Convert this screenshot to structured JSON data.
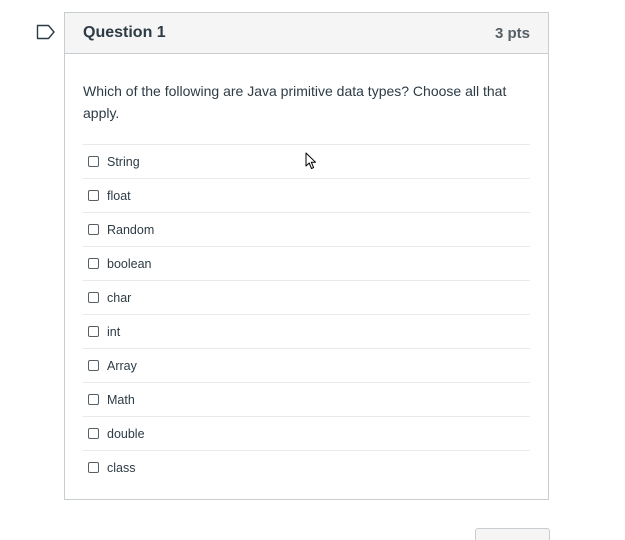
{
  "question": {
    "title": "Question 1",
    "points": "3 pts",
    "text": "Which of the following are Java primitive data types? Choose all that apply.",
    "answers": [
      {
        "label": "String"
      },
      {
        "label": "float"
      },
      {
        "label": "Random"
      },
      {
        "label": "boolean"
      },
      {
        "label": "char"
      },
      {
        "label": "int"
      },
      {
        "label": "Array"
      },
      {
        "label": "Math"
      },
      {
        "label": "double"
      },
      {
        "label": "class"
      }
    ]
  },
  "icons": {
    "flag": "flag-icon",
    "cursor": "mouse-pointer-icon",
    "checkbox": "checkbox-icon"
  },
  "colors": {
    "border": "#c7cdd1",
    "header_bg": "#f5f5f5",
    "text": "#2d3b45",
    "points": "#555f66"
  }
}
